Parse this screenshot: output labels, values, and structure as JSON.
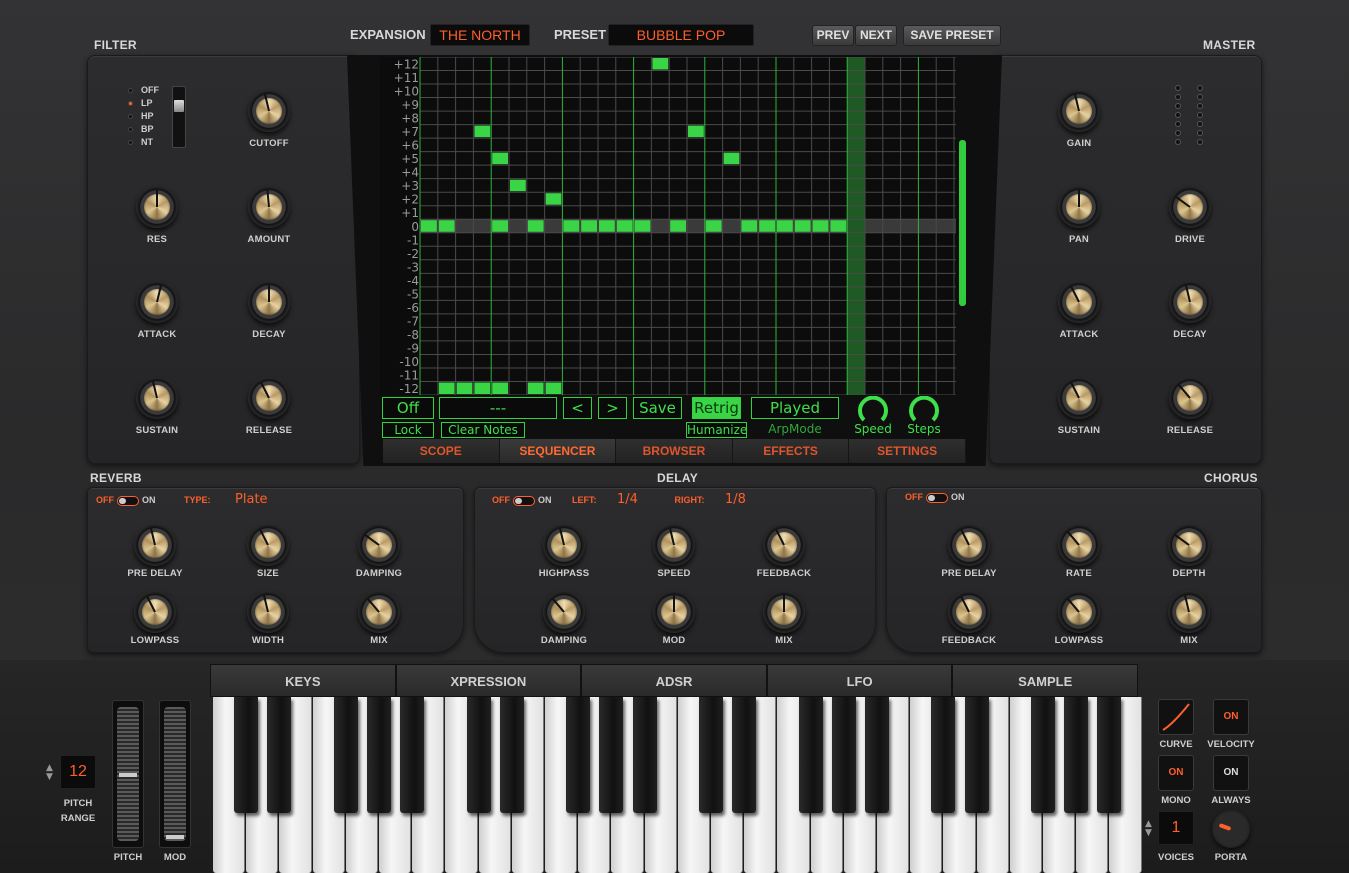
{
  "header": {
    "expansion_label": "EXPANSION",
    "expansion_value": "THE NORTH",
    "preset_label": "PRESET",
    "preset_value": "BUBBLE POP",
    "prev": "PREV",
    "next": "NEXT",
    "save_preset": "SAVE PRESET"
  },
  "filter": {
    "title": "FILTER",
    "modes": [
      "OFF",
      "LP",
      "HP",
      "BP",
      "NT"
    ],
    "selected_mode": "LP",
    "knobs": [
      {
        "label": "CUTOFF",
        "value": 0.45
      },
      {
        "label": "RES",
        "value": 0.5
      },
      {
        "label": "AMOUNT",
        "value": 0.48
      },
      {
        "label": "ATTACK",
        "value": 0.55
      },
      {
        "label": "DECAY",
        "value": 0.5
      },
      {
        "label": "SUSTAIN",
        "value": 0.45
      },
      {
        "label": "RELEASE",
        "value": 0.4
      }
    ]
  },
  "master": {
    "title": "MASTER",
    "knobs": [
      {
        "label": "GAIN",
        "value": 0.45
      },
      {
        "label": "PAN",
        "value": 0.5
      },
      {
        "label": "DRIVE",
        "value": 0.3
      },
      {
        "label": "ATTACK",
        "value": 0.4
      },
      {
        "label": "DECAY",
        "value": 0.45
      },
      {
        "label": "SUSTAIN",
        "value": 0.4
      },
      {
        "label": "RELEASE",
        "value": 0.35
      }
    ]
  },
  "sequencer": {
    "row_labels": [
      "+12",
      "+11",
      "+10",
      "+9",
      "+8",
      "+7",
      "+6",
      "+5",
      "+4",
      "+3",
      "+2",
      "+1",
      "0",
      "-1",
      "-2",
      "-3",
      "-4",
      "-5",
      "-6",
      "-7",
      "-8",
      "-9",
      "-10",
      "-11",
      "-12"
    ],
    "notes": [
      [
        0,
        12
      ],
      [
        1,
        12
      ],
      [
        1,
        24
      ],
      [
        2,
        24
      ],
      [
        3,
        5
      ],
      [
        3,
        24
      ],
      [
        4,
        12
      ],
      [
        4,
        7
      ],
      [
        4,
        24
      ],
      [
        5,
        9
      ],
      [
        6,
        12
      ],
      [
        6,
        24
      ],
      [
        7,
        10
      ],
      [
        7,
        24
      ],
      [
        8,
        12
      ],
      [
        9,
        12
      ],
      [
        10,
        12
      ],
      [
        11,
        12
      ],
      [
        12,
        12
      ],
      [
        13,
        0
      ],
      [
        14,
        12
      ],
      [
        15,
        5
      ],
      [
        16,
        12
      ],
      [
        17,
        7
      ],
      [
        18,
        12
      ],
      [
        19,
        12
      ],
      [
        20,
        12
      ],
      [
        21,
        12
      ],
      [
        22,
        12
      ],
      [
        23,
        12
      ]
    ],
    "off": "Off",
    "lock": "Lock",
    "pattern": "---",
    "clear": "Clear Notes",
    "prev": "<",
    "next": ">",
    "save": "Save",
    "retrig": "Retrig",
    "humanize": "Humanize",
    "played": "Played",
    "arpmode": "ArpMode",
    "speed": "Speed",
    "steps": "Steps"
  },
  "tabs": [
    "SCOPE",
    "SEQUENCER",
    "BROWSER",
    "EFFECTS",
    "SETTINGS"
  ],
  "active_tab": "SEQUENCER",
  "reverb": {
    "title": "REVERB",
    "off": "OFF",
    "on": "ON",
    "type_label": "TYPE:",
    "type_value": "Plate",
    "knobs": [
      {
        "label": "PRE DELAY",
        "value": 0.45
      },
      {
        "label": "SIZE",
        "value": 0.4
      },
      {
        "label": "DAMPING",
        "value": 0.3
      },
      {
        "label": "LOWPASS",
        "value": 0.4
      },
      {
        "label": "WIDTH",
        "value": 0.45
      },
      {
        "label": "MIX",
        "value": 0.35
      }
    ]
  },
  "delay": {
    "title": "DELAY",
    "off": "OFF",
    "on": "ON",
    "left_label": "LEFT:",
    "left_value": "1/4",
    "right_label": "RIGHT:",
    "right_value": "1/8",
    "knobs": [
      {
        "label": "HIGHPASS",
        "value": 0.45
      },
      {
        "label": "SPEED",
        "value": 0.45
      },
      {
        "label": "FEEDBACK",
        "value": 0.4
      },
      {
        "label": "DAMPING",
        "value": 0.35
      },
      {
        "label": "MOD",
        "value": 0.5
      },
      {
        "label": "MIX",
        "value": 0.5
      }
    ]
  },
  "chorus": {
    "title": "CHORUS",
    "off": "OFF",
    "on": "ON",
    "knobs": [
      {
        "label": "PRE DELAY",
        "value": 0.4
      },
      {
        "label": "RATE",
        "value": 0.35
      },
      {
        "label": "DEPTH",
        "value": 0.3
      },
      {
        "label": "FEEDBACK",
        "value": 0.4
      },
      {
        "label": "LOWPASS",
        "value": 0.35
      },
      {
        "label": "MIX",
        "value": 0.45
      }
    ]
  },
  "key_tabs": [
    "KEYS",
    "XPRESSION",
    "ADSR",
    "LFO",
    "SAMPLE"
  ],
  "left_controls": {
    "pitch_range_value": "12",
    "pitch_range_label": "PITCH RANGE",
    "pitch": "PITCH",
    "mod": "MOD"
  },
  "right_controls": {
    "curve": "CURVE",
    "velocity_btn": "ON",
    "velocity": "VELOCITY",
    "mono_btn": "ON",
    "mono": "MONO",
    "always_btn": "ON",
    "always": "ALWAYS",
    "voices_value": "1",
    "voices": "VOICES",
    "porta": "PORTA"
  }
}
